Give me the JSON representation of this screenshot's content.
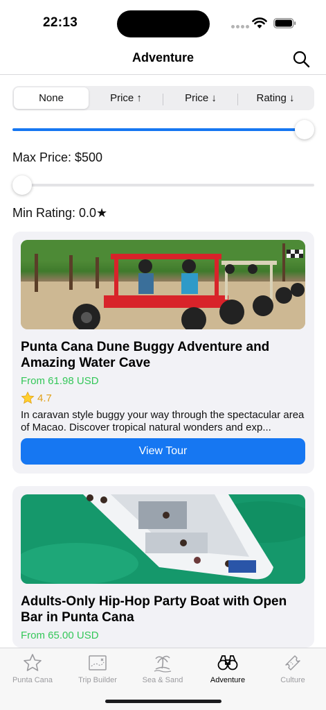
{
  "status_bar": {
    "time": "22:13"
  },
  "nav": {
    "title": "Adventure",
    "search_icon": "magnifying-glass-icon"
  },
  "sort": {
    "options": [
      "None",
      "Price ↑",
      "Price ↓",
      "Rating ↓"
    ],
    "selected": "None"
  },
  "filters": {
    "max_price": {
      "label": "Max Price: $500",
      "value": 500,
      "level": 1.0
    },
    "min_rating": {
      "label": "Min Rating: 0.0★",
      "value": 0.0,
      "level": 0.0
    }
  },
  "tours": [
    {
      "title": "Punta Cana Dune Buggy Adventure and Amazing Water Cave",
      "price": "From 61.98 USD",
      "rating": "4.7",
      "description": "In caravan style buggy your way through the spectacular area of Macao. Discover tropical natural wonders and exp...",
      "button": "View Tour"
    },
    {
      "title": "Adults-Only Hip-Hop Party Boat with Open Bar in Punta Cana",
      "price": "From 65.00 USD"
    }
  ],
  "tab_bar": {
    "items": [
      {
        "label": "Punta Cana",
        "icon": "star-icon"
      },
      {
        "label": "Trip Builder",
        "icon": "map-icon"
      },
      {
        "label": "Sea & Sand",
        "icon": "palm-island-icon"
      },
      {
        "label": "Adventure",
        "icon": "binoculars-icon"
      },
      {
        "label": "Culture",
        "icon": "ticket-icon"
      }
    ],
    "active": "Adventure"
  },
  "colors": {
    "accent": "#1677f2",
    "price": "#34c759",
    "rating": "#e0a018"
  }
}
